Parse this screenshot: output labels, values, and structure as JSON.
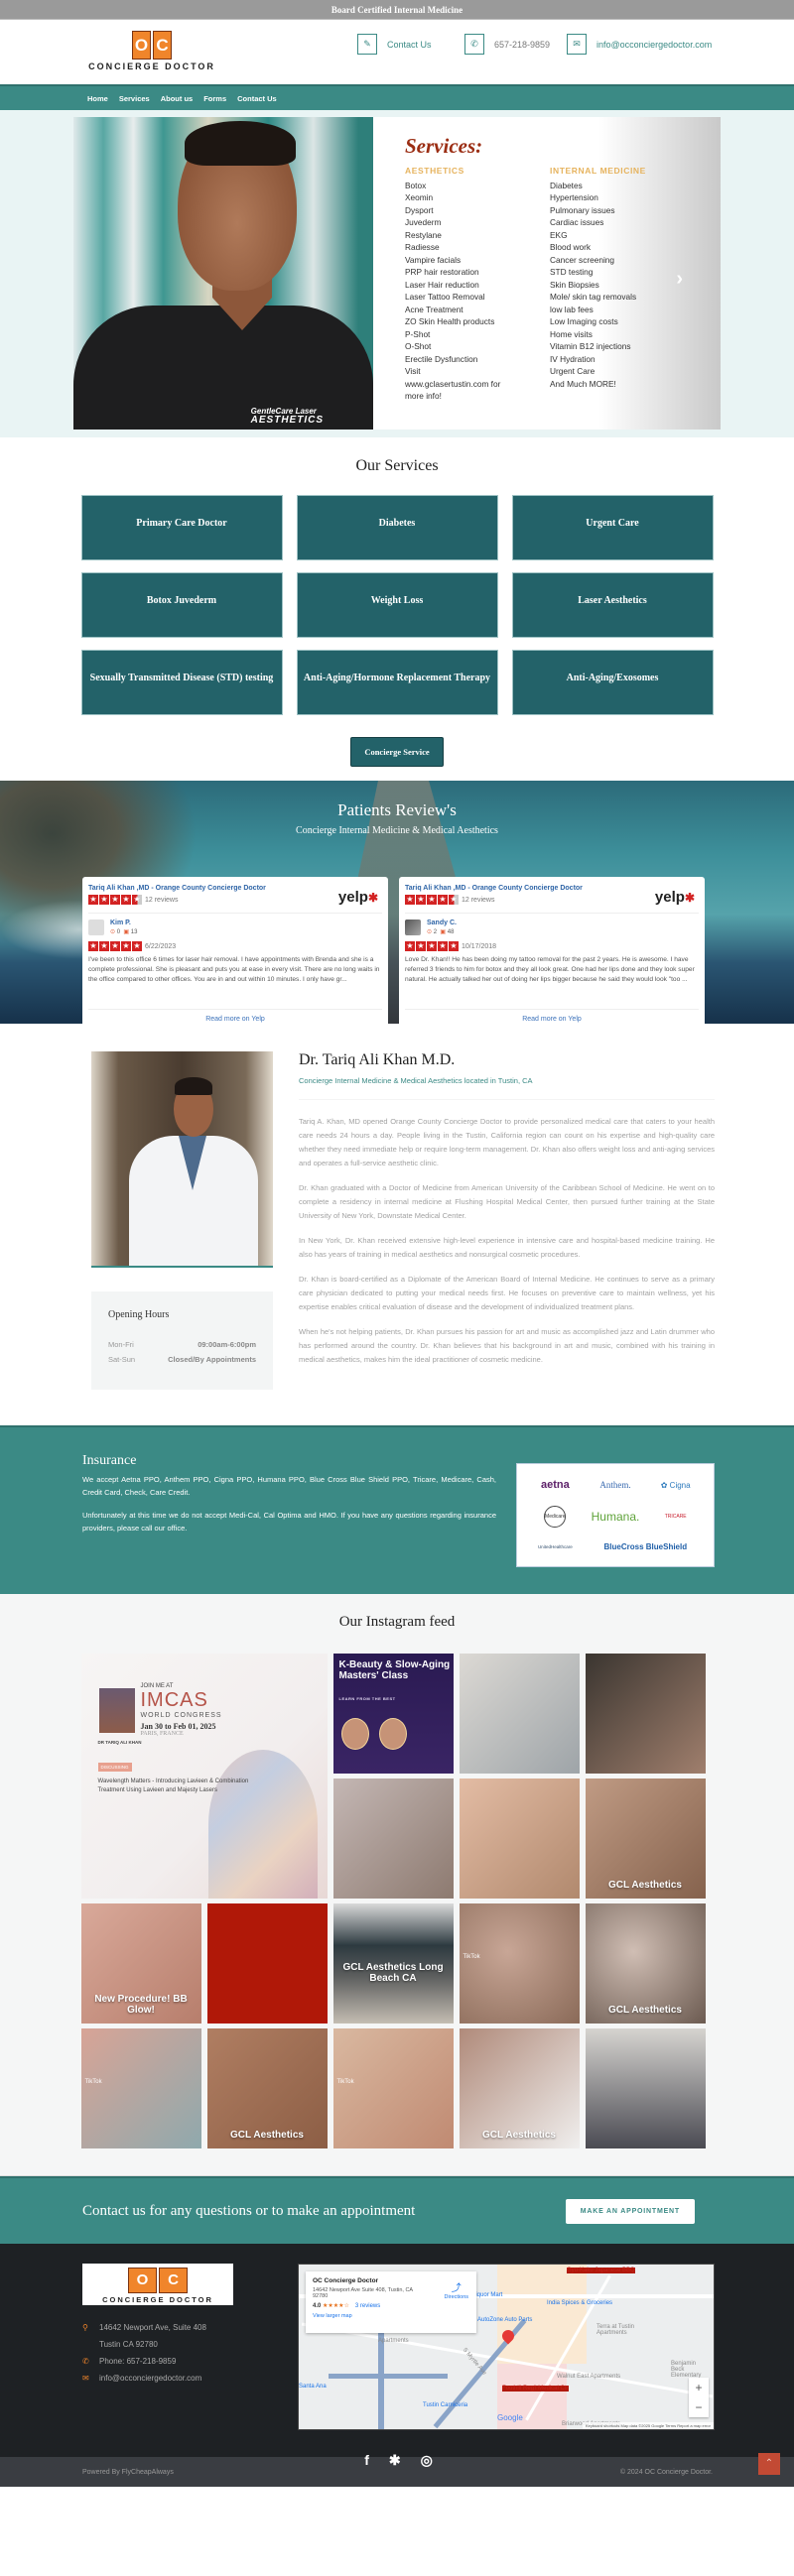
{
  "topbar": {
    "text": "Board Certified Internal Medicine"
  },
  "header": {
    "logo": {
      "letters": [
        "O",
        "C"
      ],
      "text": "CONCIERGE DOCTOR"
    },
    "contacts": [
      {
        "icon": "pencil-icon",
        "glyph": "✎",
        "label": "Contact Us"
      },
      {
        "icon": "phone-icon",
        "glyph": "✆",
        "label": "657-218-9859"
      },
      {
        "icon": "mail-icon",
        "glyph": "✉",
        "label": "info@occonciergedoctor.com"
      }
    ]
  },
  "nav": {
    "items": [
      "Home",
      "Services",
      "About us",
      "Forms",
      "Contact Us"
    ]
  },
  "hero": {
    "photo_caption_line1": "GentleCare Laser",
    "photo_caption_line2": "AESTHETICS",
    "title": "Services:",
    "aesthetics_heading": "AESTHETICS",
    "aesthetics": [
      "Botox",
      "Xeomin",
      "Dysport",
      "Juvederm",
      "Restylane",
      "Radiesse",
      "Vampire facials",
      "PRP hair restoration",
      "Laser Hair reduction",
      "Laser Tattoo Removal",
      "Acne Treatment",
      "ZO Skin Health products",
      "P-Shot",
      "O-Shot",
      "Erectile Dysfunction",
      "Visit",
      "www.gclasertustin.com for",
      "more info!"
    ],
    "internal_heading": "INTERNAL MEDICINE",
    "internal": [
      "Diabetes",
      "Hypertension",
      "Pulmonary issues",
      "Cardiac issues",
      "EKG",
      "Blood work",
      "Cancer screening",
      "STD testing",
      "Skin Biopsies",
      "Mole/ skin tag removals",
      "low lab fees",
      "Low Imaging costs",
      "Home visits",
      "Vitamin B12 injections",
      "IV Hydration",
      "Urgent Care",
      "And Much MORE!"
    ],
    "next_glyph": "›"
  },
  "services": {
    "title": "Our Services",
    "items": [
      "Primary Care Doctor",
      "Diabetes",
      "Urgent Care",
      "Botox Juvederm",
      "Weight Loss",
      "Laser Aesthetics",
      "Sexually Transmitted Disease (STD) testing",
      "Anti-Aging/Hormone Replacement Therapy",
      "Anti-Aging/Exosomes"
    ],
    "button": "Concierge Service"
  },
  "reviews": {
    "title": "Patients Review's",
    "subtitle": "Concierge Internal Medicine & Medical Aesthetics",
    "cards": [
      {
        "business": "Tariq Ali Khan ,MD - Orange County Concierge Doctor",
        "business_rating": 4.5,
        "review_count": "12 reviews",
        "reviewer": "Kim P.",
        "friends": "0",
        "reviews": "13",
        "rating": 5,
        "date": "6/22/2023",
        "text": "I've been to this office 6 times for laser hair removal. I have appointments with Brenda and she is a complete professional. She is pleasant and puts you at ease in every visit. There are no long waits in the office compared to other offices. You are in and out within 10 minutes. I only have gr...",
        "link": "Read more on Yelp"
      },
      {
        "business": "Tariq Ali Khan ,MD - Orange County Concierge Doctor",
        "business_rating": 4.5,
        "review_count": "12 reviews",
        "reviewer": "Sandy C.",
        "friends": "2",
        "reviews": "48",
        "rating": 5,
        "date": "10/17/2018",
        "text": "Love Dr. Khan!! He has been doing my tattoo removal for the past 2 years. He is awesome. I have referred 3 friends to him for botox and they all look great. One had her lips done and they look super natural. He actually talked her out of doing her lips bigger because he said they would look \"too ...",
        "link": "Read more on Yelp"
      }
    ],
    "yelp_logo": "yelp"
  },
  "about": {
    "name": "Dr. Tariq Ali Khan M.D.",
    "subtitle": "Concierge Internal Medicine & Medical Aesthetics located in Tustin, CA",
    "paragraphs": [
      "Tariq A. Khan, MD opened Orange County Concierge Doctor to provide personalized medical care that caters to your health care needs 24 hours a day. People living in the Tustin, California region can count on his expertise and high-quality care whether they need immediate help or require long-term management. Dr. Khan also offers weight loss and anti-aging services and operates a full-service aesthetic clinic.",
      "Dr. Khan graduated with a Doctor of Medicine from American University of the Caribbean School of Medicine. He went on to complete a residency in internal medicine at Flushing Hospital Medical Center, then pursued further training at the State University of New York, Downstate Medical Center.",
      "In New York, Dr. Khan received extensive high-level experience in intensive care and hospital-based medicine training. He also has years of training in medical aesthetics and nonsurgical cosmetic procedures.",
      "Dr. Khan is board-certified as a Diplomate of the American Board of Internal Medicine. He continues to serve as a primary care physician dedicated to putting your medical needs first. He focuses on preventive care to maintain wellness, yet his expertise enables critical evaluation of disease and the development of individualized treatment plans.",
      "When he's not helping patients, Dr. Khan pursues his passion for art and music as accomplished jazz and Latin drummer who has performed around the country. Dr. Khan believes that his background in art and music, combined with his training in medical aesthetics, makes him the ideal practitioner of cosmetic medicine."
    ],
    "hours": {
      "title": "Opening Hours",
      "rows": [
        {
          "days": "Mon-Fri",
          "time": "09:00am-6:00pm"
        },
        {
          "days": "Sat-Sun",
          "time": "Closed/By Appointments"
        }
      ]
    }
  },
  "insurance": {
    "title": "Insurance",
    "p1": "We accept Aetna PPO, Anthem PPO, Cigna PPO, Humana PPO, Blue Cross Blue Shield PPO, Tricare, Medicare, Cash, Credit Card, Check, Care Credit.",
    "p2": "Unfortunately at this time we do not accept Medi-Cal, Cal Optima and HMO. If you have any questions regarding insurance providers, please call our office.",
    "logos": {
      "aetna": "aetna",
      "anthem": "Anthem.",
      "cigna": "✿ Cigna",
      "medicare": "Medicare",
      "humana": "Humana.",
      "tricare": "TRICARE",
      "uhc": "UnitedHealthcare",
      "bcbs": "BlueCross BlueShield"
    }
  },
  "instagram": {
    "title": "Our Instagram feed",
    "imcas": {
      "join": "JOIN ME AT",
      "name": "IMCAS",
      "congress": "WORLD CONGRESS",
      "dates": "Jan 30 to Feb 01, 2025",
      "city": "PARIS, FRANCE",
      "doctor": "DR TARIQ ALI KHAN",
      "discussing": "DISCUSSING",
      "topic": "Wavelength Matters - Introducing Lavieen & Combination Treatment Using Lavieen and Majesty Lasers"
    },
    "kbeauty": {
      "title": "K-Beauty & Slow-Aging Masters' Class",
      "sub": "LEARN FROM THE BEST"
    },
    "captions": [
      "New Procedure! BB Glow!",
      "GCL Aesthetics Long Beach CA",
      "GCL Aesthetics",
      "GCL Aesthetics",
      "GCL Aesthetics",
      "TikTok"
    ]
  },
  "cta": {
    "text": "Contact us for any questions or to make an appointment",
    "button": "MAKE AN APPOINTMENT"
  },
  "footer": {
    "address1": "14642 Newport Ave, Suite 408",
    "address2": "Tustin CA 92780",
    "phone": "Phone: 657-218-9859",
    "email": "info@occonciergedoctor.com",
    "map": {
      "place": "OC Concierge Doctor",
      "address": "14642 Newport Ave Suite 408, Tustin, CA 92780",
      "rating": "4.0",
      "stars": "★★★★☆",
      "reviews": "3 reviews",
      "larger": "View larger map",
      "directions": "Directions",
      "labels": {
        "gyukaku": "Gyu-Kaku Japanese BBQ",
        "liquor": "Liquor Mart",
        "india": "India Spices & Groceries",
        "autozone": "AutoZone Auto Parts",
        "terra": "Terra at Tustin Apartments",
        "walnut": "Walnut East Apartments",
        "foothill": "Foothill Reg'l Medical Ctr",
        "carniceria": "Tustin Carniceria",
        "benjamin": "Benjamin Beck Elementary",
        "briarwood": "Briarwood Apartments",
        "santaana": "Santa Ana",
        "myrtle": "S Myrtle Ave",
        "apartments": "Apartments"
      },
      "attribution": "Keyboard shortcuts   Map data ©2025 Google   Terms   Report a map error",
      "google": "Google"
    },
    "social": [
      "f",
      "✱",
      "◎"
    ],
    "powered_by": "Powered By  FlyCheapAlways",
    "copyright": "©  2024 OC Concierge Doctor."
  }
}
